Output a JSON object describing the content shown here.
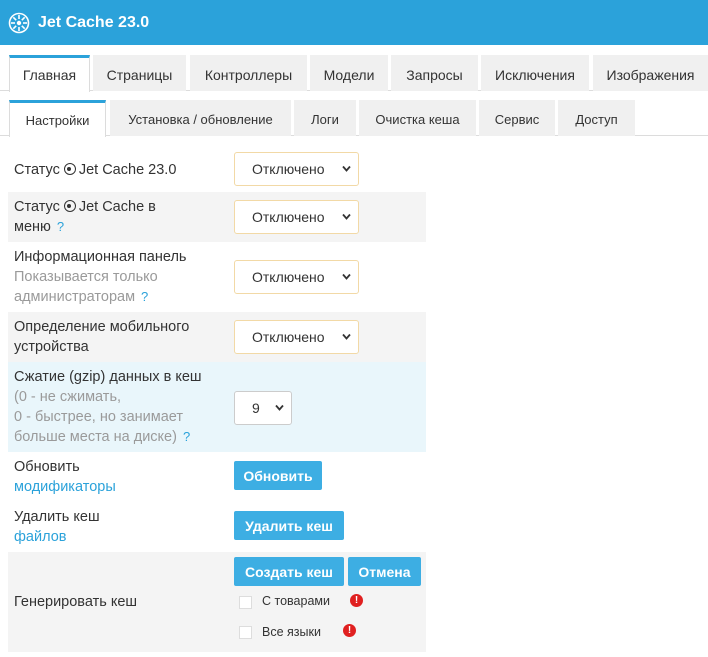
{
  "app": {
    "title": "Jet Cache 23.0",
    "logo_icon": "spinner-wheel-icon"
  },
  "tabs_main": [
    "Главная",
    "Страницы",
    "Контроллеры",
    "Модели",
    "Запросы",
    "Исключения",
    "Изображения"
  ],
  "tabs_sub": [
    "Настройки",
    "Установка / обновление",
    "Логи",
    "Очистка кеша",
    "Сервис",
    "Доступ"
  ],
  "settings": {
    "status": {
      "label_a": "Статус",
      "label_b": "Jet Cache 23.0",
      "value": "Отключено"
    },
    "status_menu": {
      "label_a": "Статус",
      "label_b": "Jet Cache в",
      "label_c": "меню",
      "help": "?",
      "value": "Отключено"
    },
    "info_panel": {
      "label": "Информационная панель",
      "sub1": "Показывается только",
      "sub2": "администраторам",
      "help": "?",
      "value": "Отключено"
    },
    "mobile": {
      "label1": "Определение мобильного",
      "label2": "устройства",
      "value": "Отключено"
    },
    "gzip": {
      "label": "Сжатие (gzip) данных в кеш",
      "sub1": "(0 - не сжимать,",
      "sub2": "0 - быстрее, но занимает",
      "sub3": "больше места на диске)",
      "help": "?",
      "value": "9"
    },
    "modifiers": {
      "label1": "Обновить",
      "label2": "модификаторы",
      "button": "Обновить"
    },
    "delete_cache": {
      "label1": "Удалить кеш",
      "label2": "файлов",
      "button": "Удалить кеш"
    },
    "generate": {
      "label": "Генерировать кеш",
      "create_button": "Создать кеш",
      "cancel_button": "Отмена",
      "option1": "С товарами",
      "option2": "Все языки",
      "warn": "!"
    }
  },
  "colors": {
    "accent": "#2ba2da",
    "button": "#3daee3",
    "warning": "#e02020"
  }
}
